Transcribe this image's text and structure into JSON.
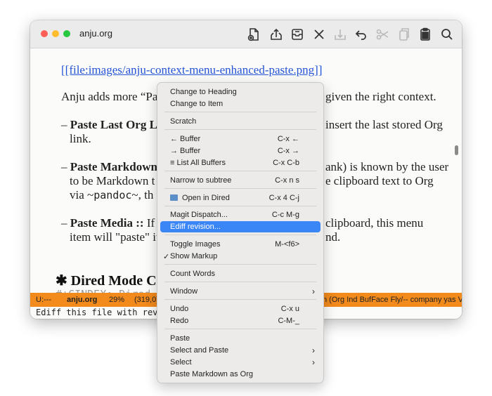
{
  "window": {
    "title": "anju.org"
  },
  "toolbar": {
    "icons": [
      "new-file-icon",
      "upload-icon",
      "archive-icon",
      "close-icon",
      "download-icon",
      "undo-icon",
      "scissors-icon",
      "copy-icon",
      "paste-icon",
      "search-icon"
    ]
  },
  "doc": {
    "link": "[[file:images/anju-context-menu-enhanced-paste.png]]",
    "p1_left": "Anju adds more “Pa",
    "p1_right": "given the right context.",
    "b1_dash": "–",
    "b1_bold": "Paste Last Org Lir",
    "b1_right": "insert the last stored Org",
    "b1_line2": "link.",
    "b2_bold": "Paste Markdown",
    "b2_right": "ank) is known by the user",
    "b2_line2_left": "to be Markdown t",
    "b2_line2_right": "e clipboard text to Org",
    "b2_line3_left": "via ~",
    "b2_line3_code": "pandoc",
    "b2_line3_right": "~, th",
    "b3_bold": "Paste Media ::",
    "b3_after": " If a",
    "b3_right": "clipboard, this menu",
    "b3_line2_left": "item will \"paste\" it",
    "b3_line2_right": "nd.",
    "heading_star": "✱",
    "heading": "Dired Mode Co",
    "cindex": "#+CINDEX: Dired"
  },
  "modeline": {
    "state": "U:---",
    "buffer": "anju.org",
    "percent": "29%",
    "position": "(319,0)",
    "modes": "n  (Org Ind BufFace Fly/-- company yas V"
  },
  "echo": {
    "text": "Ediff this file with revis"
  },
  "menu": {
    "items": [
      {
        "label": "Change to Heading",
        "shortcut": ""
      },
      {
        "label": "Change to Item",
        "shortcut": ""
      },
      {
        "label": "Scratch",
        "shortcut": ""
      },
      {
        "label": "← Buffer",
        "shortcut": "C-x ←"
      },
      {
        "label": "→ Buffer",
        "shortcut": "C-x →"
      },
      {
        "label": "≡ List All Buffers",
        "shortcut": "C-x C-b"
      },
      {
        "label": "Narrow to subtree",
        "shortcut": "C-x n s"
      },
      {
        "label": "Open in Dired",
        "shortcut": "C-x 4 C-j"
      },
      {
        "label": "Magit Dispatch...",
        "shortcut": "C-c M-g"
      },
      {
        "label": "Ediff revision...",
        "shortcut": ""
      },
      {
        "label": "Toggle Images",
        "shortcut": "M-<f6>"
      },
      {
        "label": "Show Markup",
        "shortcut": "",
        "checked": "✓"
      },
      {
        "label": "Count Words",
        "shortcut": ""
      },
      {
        "label": "Window",
        "shortcut": "",
        "submenu": "›"
      },
      {
        "label": "Undo",
        "shortcut": "C-x u"
      },
      {
        "label": "Redo",
        "shortcut": "C-M-_"
      },
      {
        "label": "Paste",
        "shortcut": ""
      },
      {
        "label": "Select and Paste",
        "shortcut": "",
        "submenu": "›"
      },
      {
        "label": "Select",
        "shortcut": "",
        "submenu": "›"
      },
      {
        "label": "Paste Markdown as Org",
        "shortcut": ""
      }
    ]
  },
  "colors": {
    "accent": "#3b86f7",
    "modeline": "#f28a1c",
    "link": "#2454d6"
  }
}
